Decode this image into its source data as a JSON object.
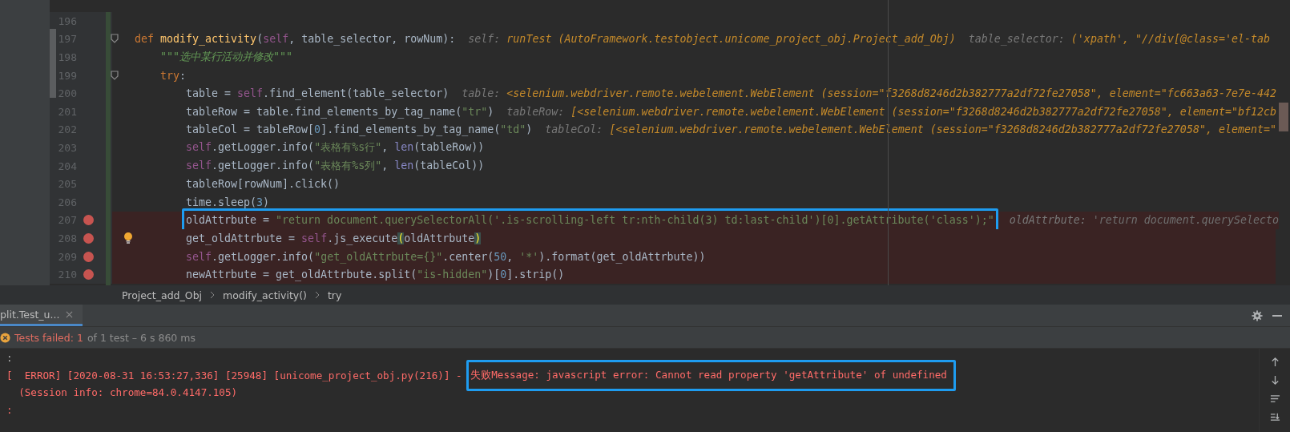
{
  "editor": {
    "lines": [
      {
        "number": "196",
        "breakpoint": false,
        "foldable": false,
        "bulb": false,
        "boxed": false
      },
      {
        "number": "197",
        "breakpoint": false,
        "foldable": true,
        "bulb": false,
        "boxed": false,
        "tokens": [
          {
            "kind": "keyword",
            "text": "def "
          },
          {
            "kind": "function",
            "text": "modify_activity"
          },
          {
            "kind": "plain",
            "text": "("
          },
          {
            "kind": "self",
            "text": "self"
          },
          {
            "kind": "plain",
            "text": ", table_selector, rowNum):"
          }
        ],
        "hints": [
          {
            "kind": "name",
            "text": "self: "
          },
          {
            "kind": "value",
            "text": "runTest (AutoFramework.testobject.unicome_project_obj.Project_add_Obj)"
          },
          {
            "kind": "name",
            "text": "  table_selector: "
          },
          {
            "kind": "value",
            "text": "('xpath', \"//div[@class='el-tab"
          }
        ],
        "children": [
          {
            "number": "198",
            "breakpoint": false,
            "foldable": false,
            "bulb": false,
            "boxed": false,
            "tokens": [
              {
                "kind": "doc",
                "text": "\"\"\"选中某行活动并修改\"\"\""
              }
            ]
          },
          {
            "number": "199",
            "breakpoint": false,
            "foldable": true,
            "bulb": false,
            "boxed": false,
            "tokens": [
              {
                "kind": "keyword",
                "text": "try"
              },
              {
                "kind": "plain",
                "text": ":"
              }
            ],
            "children": [
              {
                "number": "200",
                "breakpoint": false,
                "foldable": false,
                "bulb": false,
                "boxed": false,
                "tokens": [
                  {
                    "kind": "plain",
                    "text": "table = "
                  },
                  {
                    "kind": "self",
                    "text": "self"
                  },
                  {
                    "kind": "plain",
                    "text": ".find_element(table_selector)"
                  }
                ],
                "hints": [
                  {
                    "kind": "name",
                    "text": "table: "
                  },
                  {
                    "kind": "value",
                    "text": "<selenium.webdriver.remote.webelement.WebElement (session=\"f3268d8246d2b382777a2df72fe27058\", element=\"fc663a63-7e7e-442"
                  }
                ]
              },
              {
                "number": "201",
                "breakpoint": false,
                "foldable": false,
                "bulb": false,
                "boxed": false,
                "tokens": [
                  {
                    "kind": "plain",
                    "text": "tableRow = table.find_elements_by_tag_name("
                  },
                  {
                    "kind": "string",
                    "text": "\"tr\""
                  },
                  {
                    "kind": "plain",
                    "text": ")"
                  }
                ],
                "hints": [
                  {
                    "kind": "name",
                    "text": "tableRow: "
                  },
                  {
                    "kind": "value",
                    "text": "[<selenium.webdriver.remote.webelement.WebElement (session=\"f3268d8246d2b382777a2df72fe27058\", element=\"bf12cb"
                  }
                ]
              },
              {
                "number": "202",
                "breakpoint": false,
                "foldable": false,
                "bulb": false,
                "boxed": false,
                "tokens": [
                  {
                    "kind": "plain",
                    "text": "tableCol = tableRow["
                  },
                  {
                    "kind": "number",
                    "text": "0"
                  },
                  {
                    "kind": "plain",
                    "text": "].find_elements_by_tag_name("
                  },
                  {
                    "kind": "string",
                    "text": "\"td\""
                  },
                  {
                    "kind": "plain",
                    "text": ")"
                  }
                ],
                "hints": [
                  {
                    "kind": "name",
                    "text": "tableCol: "
                  },
                  {
                    "kind": "value",
                    "text": "[<selenium.webdriver.remote.webelement.WebElement (session=\"f3268d8246d2b382777a2df72fe27058\", element=\""
                  }
                ]
              },
              {
                "number": "203",
                "breakpoint": false,
                "foldable": false,
                "bulb": false,
                "boxed": false,
                "tokens": [
                  {
                    "kind": "self",
                    "text": "self"
                  },
                  {
                    "kind": "plain",
                    "text": ".getLogger.info("
                  },
                  {
                    "kind": "string",
                    "text": "\"表格有%s行\""
                  },
                  {
                    "kind": "plain",
                    "text": ", "
                  },
                  {
                    "kind": "builtin",
                    "text": "len"
                  },
                  {
                    "kind": "plain",
                    "text": "(tableRow))"
                  }
                ]
              },
              {
                "number": "204",
                "breakpoint": false,
                "foldable": false,
                "bulb": false,
                "boxed": false,
                "tokens": [
                  {
                    "kind": "self",
                    "text": "self"
                  },
                  {
                    "kind": "plain",
                    "text": ".getLogger.info("
                  },
                  {
                    "kind": "string",
                    "text": "\"表格有%s列\""
                  },
                  {
                    "kind": "plain",
                    "text": ", "
                  },
                  {
                    "kind": "builtin",
                    "text": "len"
                  },
                  {
                    "kind": "plain",
                    "text": "(tableCol))"
                  }
                ]
              },
              {
                "number": "205",
                "breakpoint": false,
                "foldable": false,
                "bulb": false,
                "boxed": false,
                "tokens": [
                  {
                    "kind": "plain",
                    "text": "tableRow[rowNum].click()"
                  }
                ]
              },
              {
                "number": "206",
                "breakpoint": false,
                "foldable": false,
                "bulb": false,
                "boxed": false,
                "tokens": [
                  {
                    "kind": "plain",
                    "text": "time.sleep("
                  },
                  {
                    "kind": "number",
                    "text": "3"
                  },
                  {
                    "kind": "plain",
                    "text": ")"
                  }
                ]
              },
              {
                "number": "207",
                "breakpoint": true,
                "foldable": false,
                "bulb": false,
                "boxed": true,
                "tokens": [
                  {
                    "kind": "plain",
                    "text": "oldAttrbute = "
                  },
                  {
                    "kind": "string",
                    "text": "\"return document.querySelectorAll('.is-scrolling-left tr:nth-child(3) td:last-child')[0].getAttribute('class');\""
                  }
                ],
                "hints": [
                  {
                    "kind": "name",
                    "text": "oldAttrbute: "
                  },
                  {
                    "kind": "muted",
                    "text": "'return document.querySelecto"
                  }
                ]
              },
              {
                "number": "208",
                "breakpoint": true,
                "foldable": false,
                "bulb": true,
                "boxed": false,
                "tokens": [
                  {
                    "kind": "plain",
                    "text": "get_oldAttrbute = "
                  },
                  {
                    "kind": "self",
                    "text": "self"
                  },
                  {
                    "kind": "plain",
                    "text": ".js_execute"
                  },
                  {
                    "kind": "brace",
                    "text": "("
                  },
                  {
                    "kind": "plain",
                    "text": "oldAttrbute"
                  },
                  {
                    "kind": "brace",
                    "text": ")"
                  }
                ]
              },
              {
                "number": "209",
                "breakpoint": true,
                "foldable": false,
                "bulb": false,
                "boxed": false,
                "tokens": [
                  {
                    "kind": "self",
                    "text": "self"
                  },
                  {
                    "kind": "plain",
                    "text": ".getLogger.info("
                  },
                  {
                    "kind": "string",
                    "text": "\"get_oldAttrbute={}\""
                  },
                  {
                    "kind": "plain",
                    "text": ".center("
                  },
                  {
                    "kind": "number",
                    "text": "50"
                  },
                  {
                    "kind": "plain",
                    "text": ", "
                  },
                  {
                    "kind": "string",
                    "text": "'*'"
                  },
                  {
                    "kind": "plain",
                    "text": ").format(get_oldAttrbute))"
                  }
                ]
              },
              {
                "number": "210",
                "breakpoint": true,
                "foldable": false,
                "bulb": false,
                "boxed": false,
                "tokens": [
                  {
                    "kind": "plain",
                    "text": "newAttrbute = get_oldAttrbute.split("
                  },
                  {
                    "kind": "string",
                    "text": "\"is-hidden\""
                  },
                  {
                    "kind": "plain",
                    "text": ")["
                  },
                  {
                    "kind": "number",
                    "text": "0"
                  },
                  {
                    "kind": "plain",
                    "text": "].strip()"
                  }
                ]
              }
            ]
          }
        ]
      }
    ]
  },
  "breadcrumbs": [
    "Project_add_Obj",
    "modify_activity()",
    "try"
  ],
  "run_panel": {
    "tab": {
      "label": "plit.Test_u...",
      "selected": true
    },
    "status": {
      "failed_label": "Tests failed: 1",
      "summary": "of 1 test – 6 s 860 ms"
    },
    "console": [
      {
        "kind": "plain",
        "boxed": false,
        "text": ":"
      },
      {
        "kind": "error",
        "boxed": true,
        "text": "[  ERROR] [2020-08-31 16:53:27,336] [25948] [unicome_project_obj.py(216)] - ",
        "boxed_text": "失败Message: javascript error: Cannot read property 'getAttribute' of undefined"
      },
      {
        "kind": "error",
        "boxed": false,
        "text": "  (Session info: chrome=84.0.4147.105)"
      },
      {
        "kind": "error",
        "boxed": false,
        "text": ":"
      }
    ]
  }
}
